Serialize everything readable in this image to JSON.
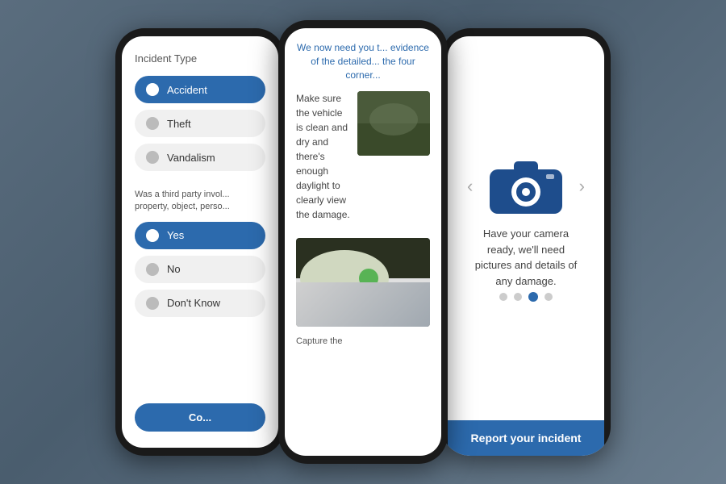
{
  "background": {
    "color": "#6a7d8f"
  },
  "phone1": {
    "title": "Incident Type",
    "options": [
      {
        "label": "Accident",
        "selected": true
      },
      {
        "label": "Theft",
        "selected": false
      },
      {
        "label": "Vandalism",
        "selected": false
      }
    ],
    "third_party_text": "Was a third party invol... property, object, perso...",
    "third_party_options": [
      {
        "label": "Yes",
        "selected": true
      },
      {
        "label": "No",
        "selected": false
      },
      {
        "label": "Don't Know",
        "selected": false
      }
    ],
    "continue_label": "Co..."
  },
  "phone2": {
    "header_text": "We now need you t... evidence of the detailed... the four corner...",
    "instruction_text": "Make sure the vehicle is clean and dry and there's enough daylight to clearly view the damage.",
    "capture_label": "Capture the"
  },
  "phone3": {
    "camera_text": "Have your camera ready, we'll need pictures and details of any damage.",
    "arrow_left": "‹",
    "arrow_right": "›",
    "dots": [
      {
        "active": false
      },
      {
        "active": false
      },
      {
        "active": true
      },
      {
        "active": false
      }
    ],
    "report_label": "Report your incident",
    "camera_icon_color": "#1e4d8c"
  }
}
